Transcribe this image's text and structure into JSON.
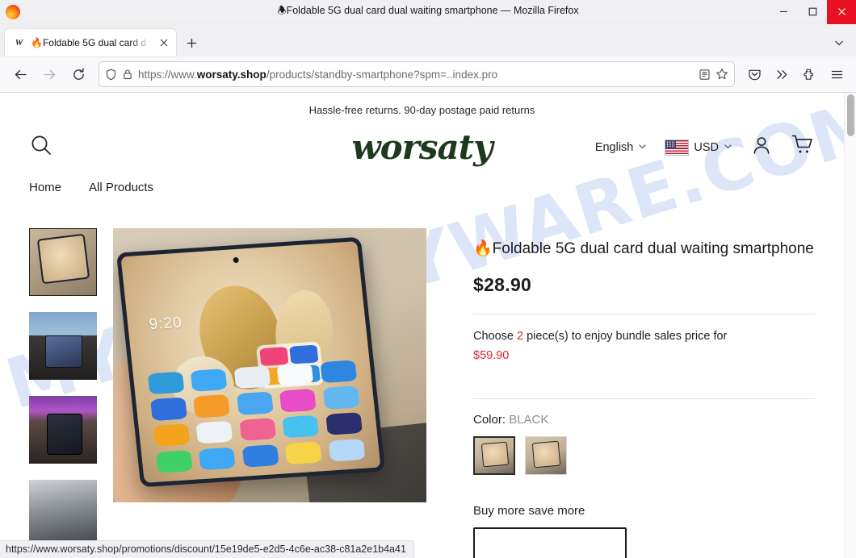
{
  "window": {
    "title": "🕭Foldable 5G dual card dual waiting smartphone — Mozilla Firefox",
    "minimize_label": "Minimize",
    "maximize_label": "Maximize",
    "close_label": "Close"
  },
  "tabs": {
    "items": [
      {
        "favicon_text": "W",
        "title": "🔥Foldable 5G dual card d",
        "close_label": "×"
      }
    ],
    "new_tab_label": "+",
    "list_all_label": "List all tabs"
  },
  "toolbar": {
    "back_label": "Back",
    "forward_label": "Forward",
    "reload_label": "Reload",
    "url_prefix": "https://www.",
    "url_domain": "worsaty.shop",
    "url_path": "/products/standby-smartphone?spm=..index.pro",
    "reader_label": "Reader view",
    "bookmark_label": "Bookmark this page",
    "pocket_label": "Save to Pocket",
    "overflow_label": "More tools",
    "extensions_label": "Extensions",
    "menu_label": "Open application menu"
  },
  "site": {
    "announcement": "Hassle-free returns. 90-day postage paid returns",
    "brand": "worsaty",
    "search_label": "Search",
    "language": "English",
    "currency": "USD",
    "account_label": "Account",
    "cart_label": "Cart",
    "nav": [
      {
        "label": "Home"
      },
      {
        "label": "All Products"
      }
    ],
    "watermark": "MYANTISPYWARE.COM"
  },
  "product": {
    "title": "🔥Foldable 5G dual card dual waiting smartphone",
    "price": "$28.90",
    "bundle_prefix": "Choose ",
    "bundle_qty": "2",
    "bundle_middle": " piece(s) to enjoy bundle sales price for",
    "bundle_price": "$59.90",
    "color_label": "Color:",
    "color_value": "BLACK",
    "buy_more_label": "Buy more save more",
    "thumbnails": [
      {
        "alt": "foldable phone held in hand, gold wallpaper"
      },
      {
        "alt": "phone mounted on car dashboard with navigation"
      },
      {
        "alt": "phone on desk with purple lighting and smartwatch"
      },
      {
        "alt": "phone on table, partially visible"
      }
    ],
    "main_image_alt": "Hand holding open foldable smartphone showing gold wallpaper and app icons",
    "main_image_clock": "9:20",
    "swatches": [
      {
        "alt": "BLACK variant",
        "selected": true
      },
      {
        "alt": "BLACK variant alternate",
        "selected": false
      }
    ]
  },
  "status": {
    "link_url": "https://www.worsaty.shop/promotions/discount/15e19de5-e2d5-4c6e-ac38-c81a2e1b4a41"
  },
  "colors": {
    "brand_green": "#1e3a1e",
    "accent_red": "#e02727",
    "close_red": "#e81123",
    "watermark_blue": "#c9d8f5"
  }
}
